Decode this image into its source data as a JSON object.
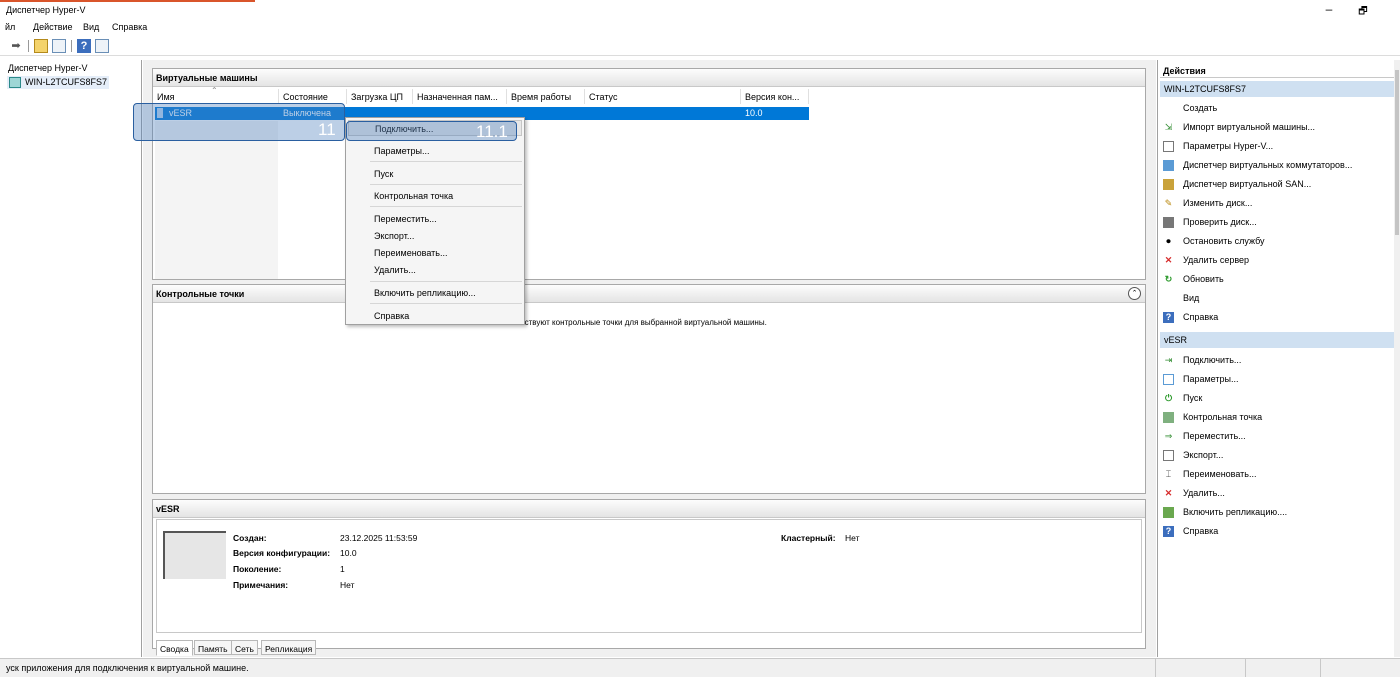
{
  "window": {
    "title": "Диспетчер Hyper-V",
    "minimize": "–",
    "restore": "🗗"
  },
  "menu": [
    "йл",
    "Действие",
    "Вид",
    "Справка"
  ],
  "tree": {
    "root": "Диспетчер Hyper-V",
    "server": "WIN-L2TCUFS8FS7"
  },
  "vm_pane": {
    "title": "Виртуальные машины",
    "columns": [
      "Имя",
      "Состояние",
      "Загрузка ЦП",
      "Назначенная пам...",
      "Время работы",
      "Статус",
      "Версия кон..."
    ],
    "rows": [
      {
        "name": "vESR",
        "state": "Выключена",
        "version": "10.0"
      }
    ]
  },
  "checkpoints_pane": {
    "title": "Контрольные точки",
    "message": "тствуют контрольные точки для выбранной виртуальной машины."
  },
  "context_menu": [
    "Подключить...",
    "Параметры...",
    "Пуск",
    "Контрольная точка",
    "Переместить...",
    "Экспорт...",
    "Переименовать...",
    "Удалить...",
    "Включить репликацию...",
    "Справка"
  ],
  "annotations": {
    "row_label": "11",
    "item_label": "11.1"
  },
  "details": {
    "title": "vESR",
    "created_label": "Создан:",
    "created_value": "23.12.2025 11:53:59",
    "config_label": "Версия конфигурации:",
    "config_value": "10.0",
    "generation_label": "Поколение:",
    "generation_value": "1",
    "notes_label": "Примечания:",
    "notes_value": "Нет",
    "cluster_label": "Кластерный:",
    "cluster_value": "Нет",
    "tabs": [
      "Сводка",
      "Память",
      "Сеть",
      "Репликация"
    ]
  },
  "actions": {
    "title": "Действия",
    "server_group": "WIN-L2TCUFS8FS7",
    "server_items": [
      "Создать",
      "Импорт виртуальной машины...",
      "Параметры Hyper-V...",
      "Диспетчер виртуальных коммутаторов...",
      "Диспетчер виртуальной SAN...",
      "Изменить диск...",
      "Проверить диск...",
      "Остановить службу",
      "Удалить сервер",
      "Обновить",
      "Вид",
      "Справка"
    ],
    "vm_group": "vESR",
    "vm_items": [
      "Подключить...",
      "Параметры...",
      "Пуск",
      "Контрольная точка",
      "Переместить...",
      "Экспорт...",
      "Переименовать...",
      "Удалить...",
      "Включить репликацию....",
      "Справка"
    ]
  },
  "status_bar": {
    "text": "уск приложения для подключения к виртуальной машине."
  },
  "colors": {
    "selection": "#0078d7",
    "annotation": "#4f81bd",
    "group_header": "#cfe0f1"
  }
}
